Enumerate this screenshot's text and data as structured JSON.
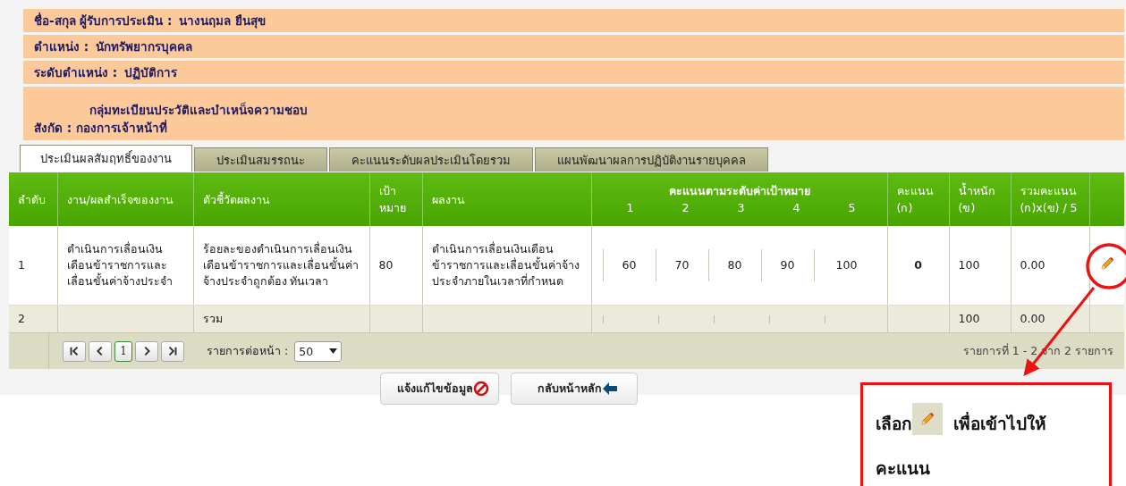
{
  "info_rows": [
    {
      "kind": "pair",
      "label": "ชื่อ-สกุล ผู้รับการประเมิน :",
      "value": "นางนฤมล ยืนสุข"
    },
    {
      "kind": "pair",
      "label": "ตำแหน่ง :",
      "value": "นักทรัพยากรบุคคล"
    },
    {
      "kind": "pair",
      "label": "ระดับตำแหน่ง :",
      "value": "ปฏิบัติการ"
    },
    {
      "kind": "stacked",
      "value": "กลุ่มทะเบียนประวัติและบำเหน็จความชอบ",
      "label": "สังกัด : กองการเจ้าหน้าที่"
    }
  ],
  "tabs": [
    {
      "label": "ประเมินผลสัมฤทธิ์ของงาน",
      "selected": true
    },
    {
      "label": "ประเมินสมรรถนะ",
      "selected": false
    },
    {
      "label": "คะแนนระดับผลประเมินโดยรวม",
      "selected": false
    },
    {
      "label": "แผนพัฒนาผลการปฏิบัติงานรายบุคคล",
      "selected": false
    }
  ],
  "table": {
    "columns": {
      "no": "ลำดับ",
      "task": "งาน/ผลสำเร็จของงาน",
      "indicator": "ตัวชี้วัดผลงาน",
      "target": "เป้าหมาย",
      "result": "ผลงาน",
      "levels_title": "คะแนนตามระดับค่าเป้าหมาย",
      "levels": [
        "1",
        "2",
        "3",
        "4",
        "5"
      ],
      "score": "คะแนน (ก)",
      "weight": "น้ำหนัก (ข)",
      "total": "รวมคะแนน (ก)x(ข) / 5"
    },
    "rows": [
      {
        "kind": "item",
        "no": "1",
        "task": "ดำเนินการเลื่อนเงินเดือนข้าราชการและเลื่อนขั้นค่าจ้างประจำ",
        "indicator": "ร้อยละของดำเนินการเลื่อนเงินเดือนข้าราชการและเลื่อนขั้นค่าจ้างประจำถูกต้อง ทันเวลา",
        "target": "80",
        "result": "ดำเนินการเลื่อนเงินเดือนข้าราชการและเลื่อนขั้นค่าจ้างประจำภายในเวลาที่กำหนด",
        "levels": [
          "60",
          "70",
          "80",
          "90",
          "100"
        ],
        "score": "0",
        "weight": "100",
        "total": "0.00",
        "editable": true
      },
      {
        "kind": "summary",
        "no": "2",
        "indicator": "รวม",
        "weight": "100",
        "total": "0.00",
        "editable": false
      }
    ]
  },
  "pager": {
    "pages": [
      {
        "label": "1",
        "selected": true
      }
    ],
    "per_page_label": "รายการต่อหน้า :",
    "per_page": "50",
    "summary": "รายการที่ 1 - 2 จาก 2 รายการ"
  },
  "buttons": [
    {
      "kind": "report",
      "label": "แจ้งแก้ไขข้อมูล"
    },
    {
      "kind": "back",
      "label": "กลับหน้าหลัก"
    }
  ],
  "callout": {
    "prefix": "เลือก",
    "suffix": "เพื่อเข้าไปให้",
    "continuation": "คะแนน"
  }
}
